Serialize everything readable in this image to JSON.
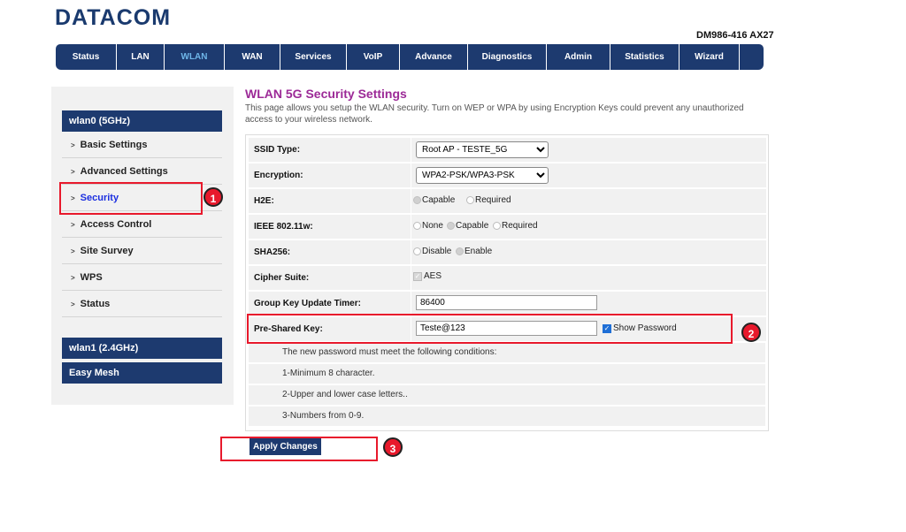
{
  "brand": {
    "logo": "DATACOM",
    "model": "DM986-416 AX27"
  },
  "nav": {
    "items": [
      "Status",
      "LAN",
      "WLAN",
      "WAN",
      "Services",
      "VoIP",
      "Advance",
      "Diagnostics",
      "Admin",
      "Statistics",
      "Wizard"
    ],
    "active": "WLAN"
  },
  "sidebar": {
    "group1": "wlan0 (5GHz)",
    "items": [
      "Basic Settings",
      "Advanced Settings",
      "Security",
      "Access Control",
      "Site Survey",
      "WPS",
      "Status"
    ],
    "active": "Security",
    "group2": "wlan1 (2.4GHz)",
    "group3": "Easy Mesh"
  },
  "page": {
    "title": "WLAN 5G Security Settings",
    "description": "This page allows you setup the WLAN security. Turn on WEP or WPA by using Encryption Keys could prevent any unauthorized access to your wireless network."
  },
  "form": {
    "ssid_type": {
      "label": "SSID Type:",
      "value": "Root AP - TESTE_5G"
    },
    "encryption": {
      "label": "Encryption:",
      "value": "WPA2-PSK/WPA3-PSK"
    },
    "h2e": {
      "label": "H2E:",
      "options": [
        "Capable",
        "Required"
      ],
      "selected": "Capable"
    },
    "ieee80211w": {
      "label": "IEEE 802.11w:",
      "options": [
        "None",
        "Capable",
        "Required"
      ],
      "selected": "Capable"
    },
    "sha256": {
      "label": "SHA256:",
      "options": [
        "Disable",
        "Enable"
      ],
      "selected": "Enable"
    },
    "cipher_suite": {
      "label": "Cipher Suite:",
      "option": "AES",
      "checked": true
    },
    "group_key_timer": {
      "label": "Group Key Update Timer:",
      "value": "86400"
    },
    "psk": {
      "label": "Pre-Shared Key:",
      "value": "Teste@123",
      "show_password_label": "Show Password",
      "show_password": true
    },
    "notes": [
      "The new password must meet the following conditions:",
      "1-Minimum 8 character.",
      "2-Upper and lower case letters..",
      "3-Numbers from 0-9."
    ]
  },
  "apply_label": "Apply Changes",
  "callouts": [
    "1",
    "2",
    "3"
  ],
  "colors": {
    "accent": "#e8192c",
    "nav": "#1d3a6f",
    "title": "#9c2a97"
  }
}
